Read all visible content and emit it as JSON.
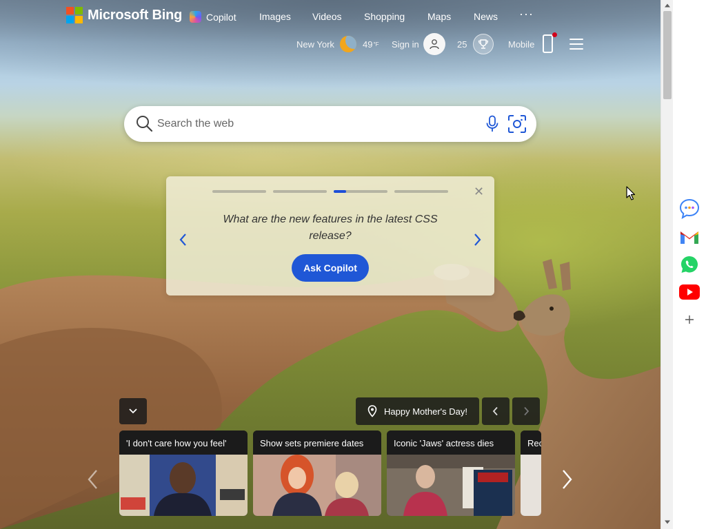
{
  "brand": {
    "name": "Microsoft Bing",
    "logo_colors": [
      "#f25022",
      "#7fba00",
      "#00a4ef",
      "#ffb900"
    ]
  },
  "nav": {
    "items": [
      "Copilot",
      "Images",
      "Videos",
      "Shopping",
      "Maps",
      "News"
    ],
    "more_icon": "ellipsis-icon"
  },
  "header": {
    "location": "New York",
    "weather_icon": "moon-icon",
    "temperature": "49",
    "temp_unit": "°F",
    "sign_in": "Sign in",
    "rewards_points": "25",
    "rewards_icon": "trophy-icon",
    "mobile": "Mobile",
    "menu_icon": "hamburger-icon"
  },
  "search": {
    "placeholder": "Search the web",
    "value": ""
  },
  "copilot_card": {
    "question": "What are the new features in the latest CSS release?",
    "button": "Ask Copilot",
    "slide_count": 4,
    "active_slide": 3
  },
  "news": {
    "banner": "Happy Mother's Day!",
    "tiles": [
      {
        "title": "'I don't care how you feel'"
      },
      {
        "title": "Show sets premiere dates"
      },
      {
        "title": "Iconic 'Jaws' actress dies"
      },
      {
        "title": "Rec"
      }
    ]
  },
  "side_panel": {
    "apps": [
      "chat-bubble-icon",
      "gmail-icon",
      "whatsapp-icon",
      "youtube-icon",
      "add-icon"
    ]
  },
  "colors": {
    "accent": "#1f57d6",
    "card_bg": "#f0ecd6"
  }
}
